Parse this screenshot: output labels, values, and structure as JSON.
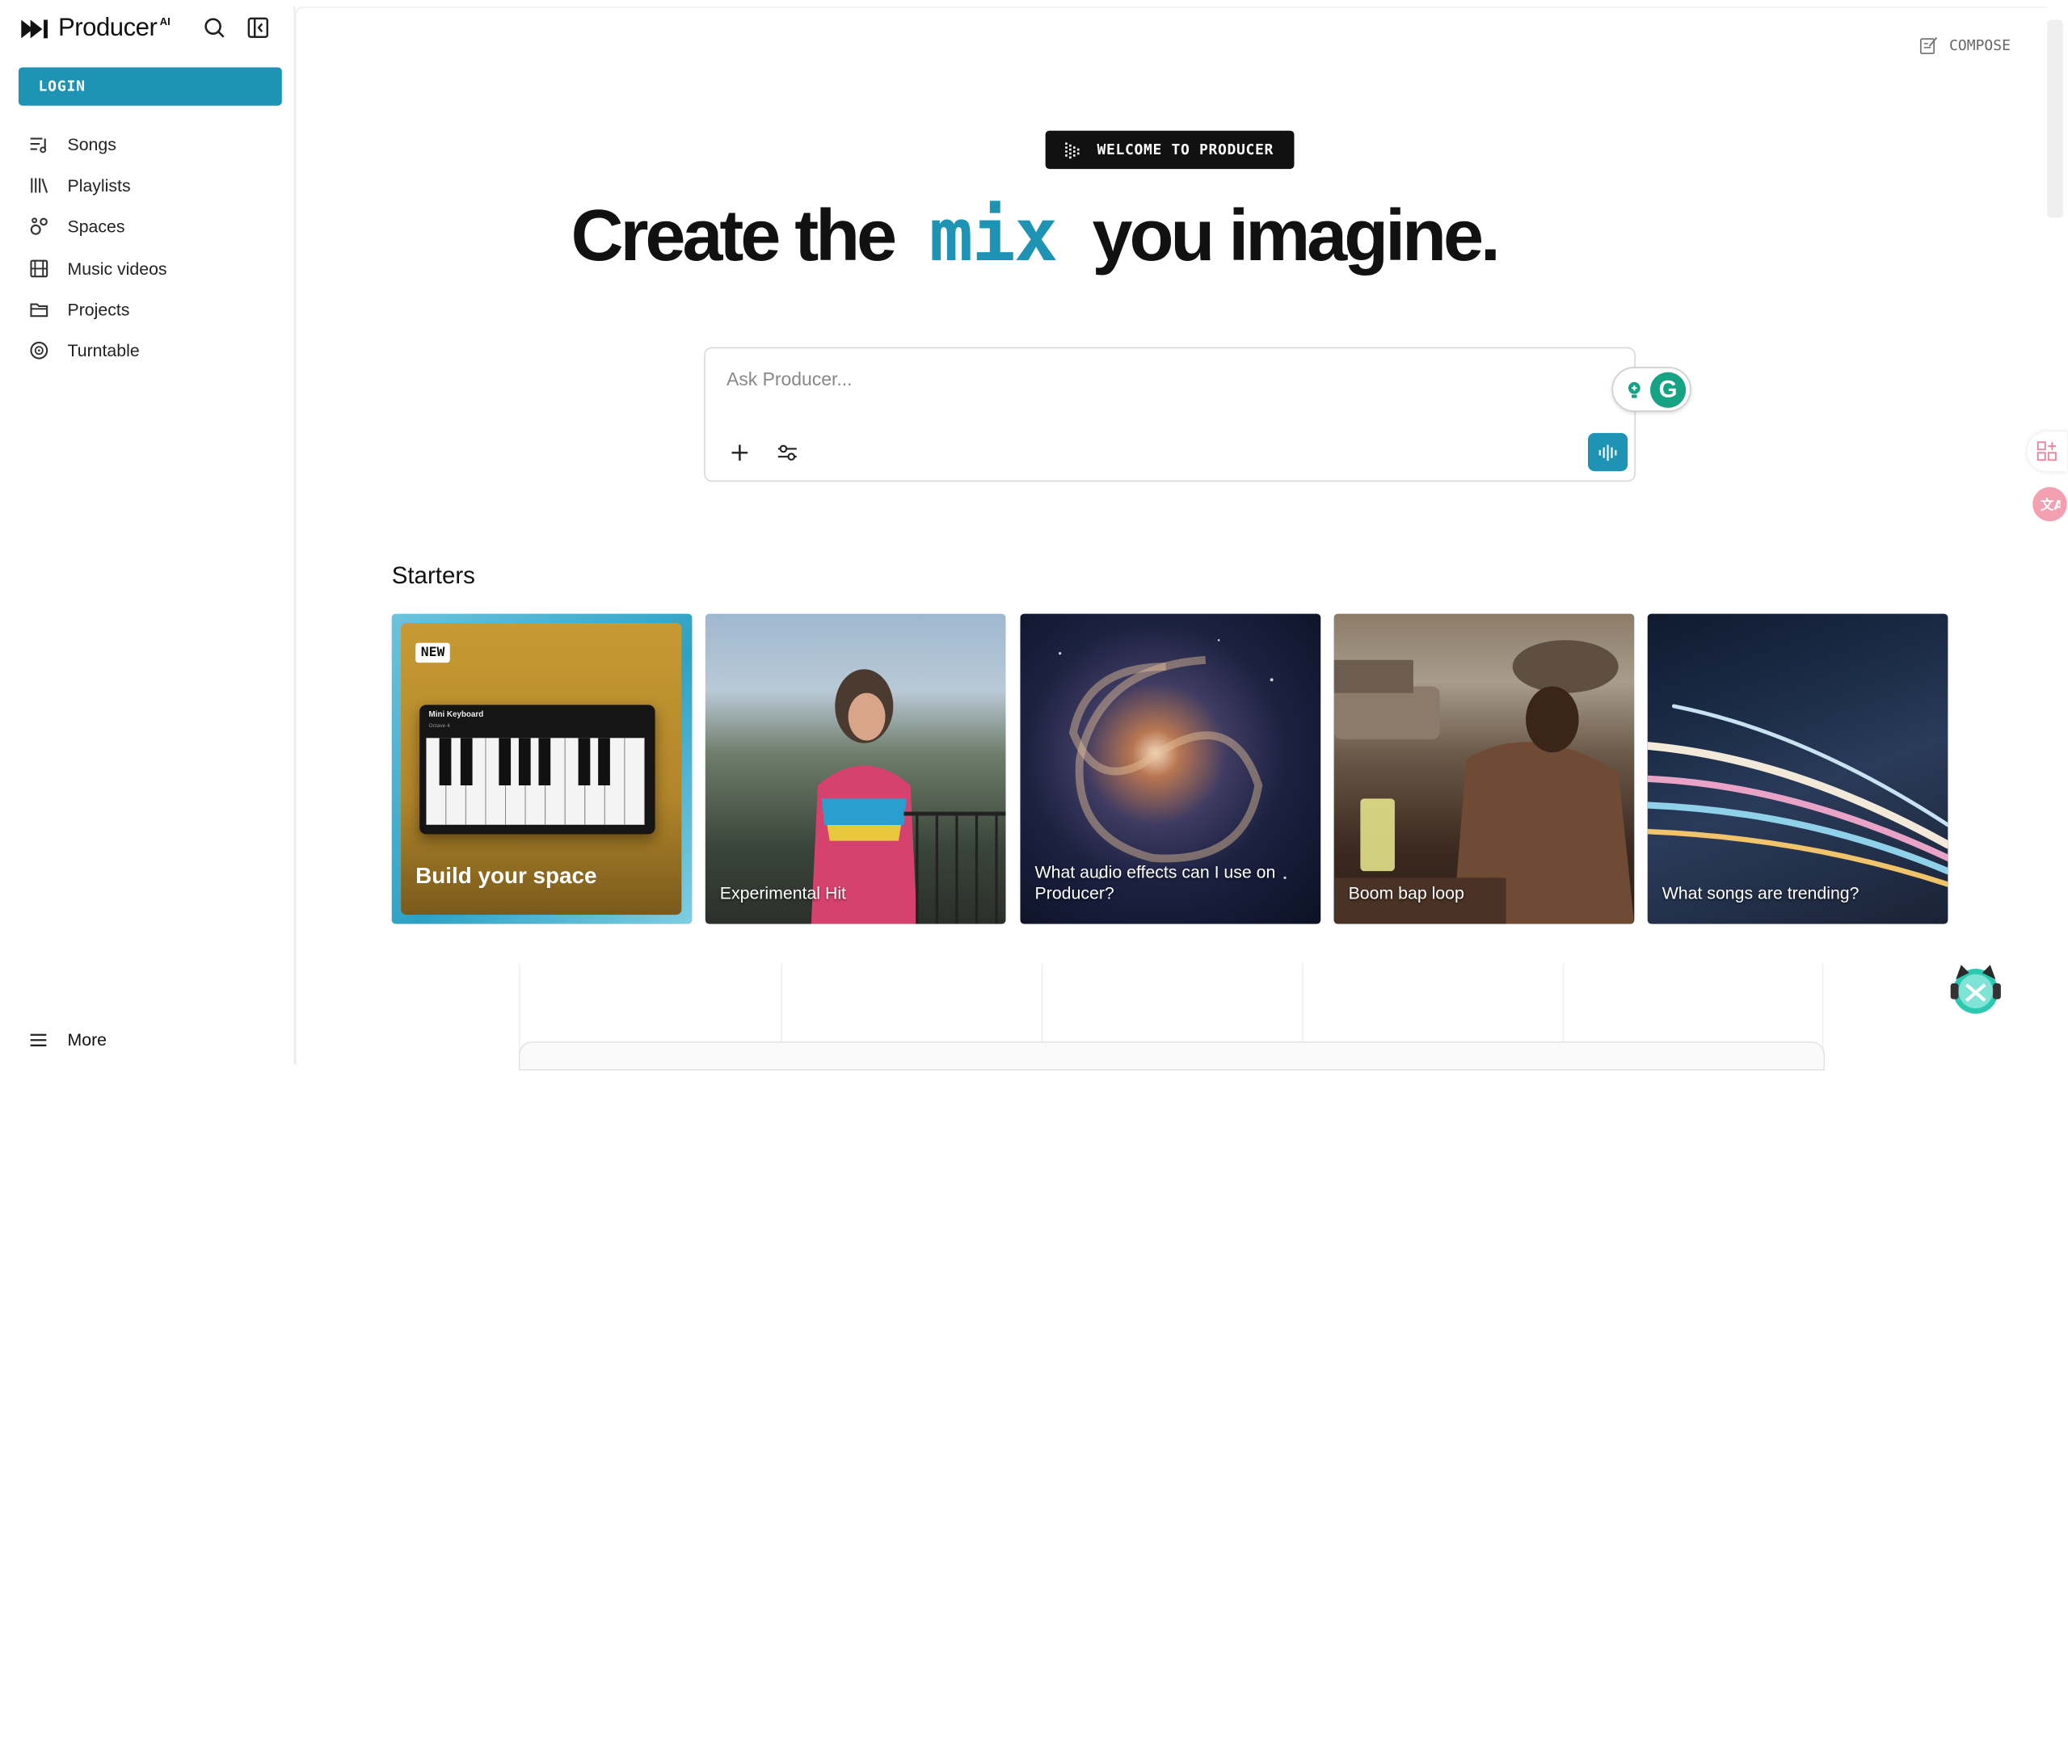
{
  "sidebar": {
    "brand": "Producer",
    "brand_sup": "AI",
    "login_label": "LOGIN",
    "items": [
      {
        "label": "Songs",
        "icon": "songs-icon"
      },
      {
        "label": "Playlists",
        "icon": "library-icon"
      },
      {
        "label": "Spaces",
        "icon": "spaces-icon"
      },
      {
        "label": "Music videos",
        "icon": "film-icon"
      },
      {
        "label": "Projects",
        "icon": "folder-icon"
      },
      {
        "label": "Turntable",
        "icon": "turntable-icon"
      }
    ],
    "more_label": "More"
  },
  "header": {
    "compose_label": "COMPOSE"
  },
  "hero": {
    "badge": "WELCOME TO PRODUCER",
    "title_before": "Create the",
    "title_accent": "mix",
    "title_after": "you imagine."
  },
  "prompt": {
    "placeholder": "Ask Producer..."
  },
  "starters": {
    "title": "Starters",
    "cards": [
      {
        "badge": "NEW",
        "label": "Build your space",
        "keyboard_title": "Mini Keyboard",
        "keyboard_sub": "Octave 4"
      },
      {
        "label": "Experimental Hit"
      },
      {
        "label": "What audio effects can I use on Producer?"
      },
      {
        "label": "Boom bap loop"
      },
      {
        "label": "What songs are trending?"
      }
    ]
  },
  "colors": {
    "accent": "#1f93b3",
    "text": "#111111",
    "grammarly": "#15a383"
  }
}
